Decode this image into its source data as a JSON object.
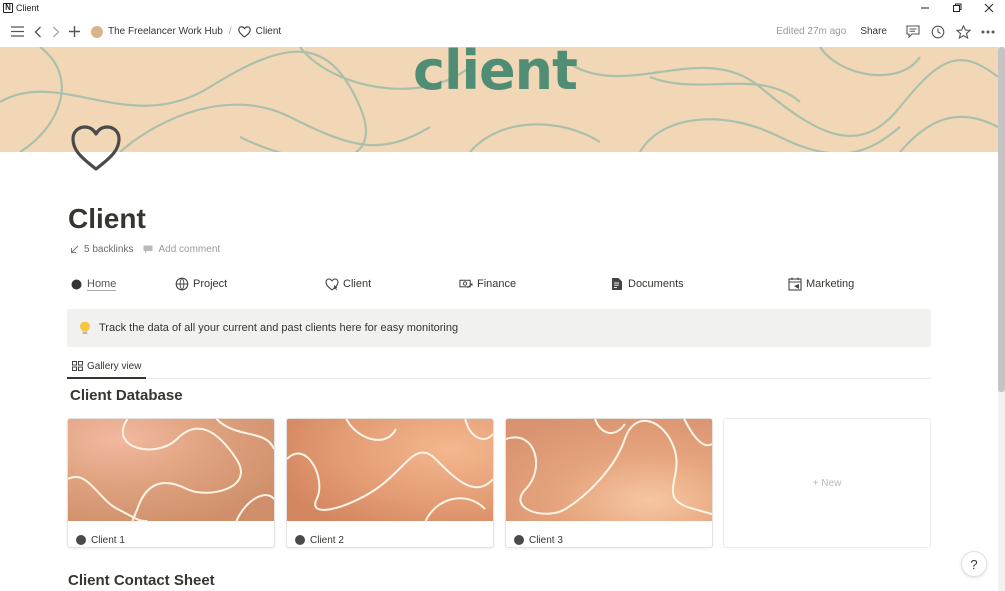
{
  "window": {
    "title": "Client",
    "controls": [
      "minimize",
      "restore",
      "close"
    ]
  },
  "topbar": {
    "breadcrumb": [
      {
        "label": "The Freelancer Work Hub",
        "icon": "avatar-emoji"
      },
      {
        "label": "Client",
        "icon": "heart-icon"
      }
    ],
    "separator": "/",
    "edited": "Edited 27m ago",
    "share": "Share"
  },
  "cover": {
    "word": "client",
    "background": "#f2d7b7",
    "accent": "#4f8e75"
  },
  "page": {
    "title": "Client",
    "backlinks": "5 backlinks",
    "add_comment": "Add comment"
  },
  "nav": [
    {
      "label": "Home",
      "icon": "circle-icon"
    },
    {
      "label": "Project",
      "icon": "globe-plus-icon"
    },
    {
      "label": "Client",
      "icon": "heart-cursor-icon"
    },
    {
      "label": "Finance",
      "icon": "money-icon"
    },
    {
      "label": "Documents",
      "icon": "document-icon"
    },
    {
      "label": "Marketing",
      "icon": "calendar-icon"
    }
  ],
  "callout": {
    "icon": "lightbulb-icon",
    "text": "Track the data of all your current and past clients here for easy monitoring"
  },
  "views": [
    {
      "label": "Gallery view",
      "icon": "gallery-icon",
      "active": true
    }
  ],
  "database": {
    "title": "Client Database",
    "cards": [
      {
        "title": "Client 1"
      },
      {
        "title": "Client 2"
      },
      {
        "title": "Client 3"
      }
    ],
    "new_label": "+ New"
  },
  "next_section": {
    "title": "Client Contact Sheet"
  },
  "help": "?"
}
